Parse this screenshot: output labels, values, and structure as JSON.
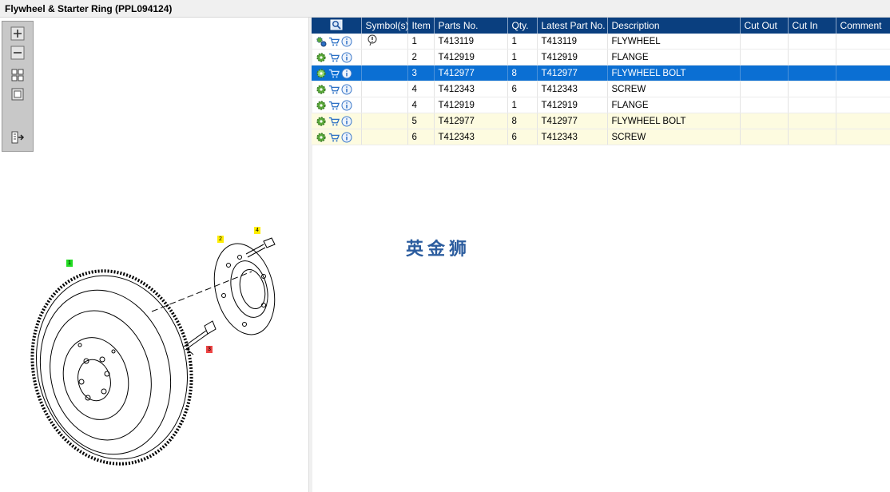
{
  "window": {
    "title": "Flywheel & Starter Ring (PPL094124)"
  },
  "toolbox": {
    "buttons": [
      {
        "name": "zoom-in",
        "icon": "plus-icon"
      },
      {
        "name": "zoom-out",
        "icon": "minus-icon"
      },
      {
        "name": "fit-all",
        "icon": "grid-icon"
      },
      {
        "name": "fit-page",
        "icon": "square-icon"
      },
      {
        "name": "export",
        "icon": "export-icon"
      }
    ]
  },
  "drawing": {
    "callouts": [
      {
        "label": "1",
        "color": "#22dd22"
      },
      {
        "label": "2",
        "color": "#ffee00"
      },
      {
        "label": "3",
        "color": "#ee4444"
      },
      {
        "label": "4",
        "color": "#ffee00"
      }
    ]
  },
  "grid": {
    "columns": [
      "",
      "Symbol(s)",
      "Item",
      "Parts No.",
      "Qty.",
      "Latest Part No.",
      "Description",
      "Cut Out",
      "Cut In",
      "Comment"
    ],
    "rows": [
      {
        "item": "1",
        "part": "T413119",
        "qty": "1",
        "latest": "T413119",
        "desc": "FLYWHEEL",
        "cutout": "",
        "cutin": "",
        "comment": "",
        "state": "normal",
        "symbol": true,
        "gears": "double"
      },
      {
        "item": "2",
        "part": "T412919",
        "qty": "1",
        "latest": "T412919",
        "desc": "FLANGE",
        "cutout": "",
        "cutin": "",
        "comment": "",
        "state": "normal",
        "symbol": false,
        "gears": "single"
      },
      {
        "item": "3",
        "part": "T412977",
        "qty": "8",
        "latest": "T412977",
        "desc": "FLYWHEEL BOLT",
        "cutout": "",
        "cutin": "",
        "comment": "",
        "state": "selected",
        "symbol": false,
        "gears": "single"
      },
      {
        "item": "4",
        "part": "T412343",
        "qty": "6",
        "latest": "T412343",
        "desc": "SCREW",
        "cutout": "",
        "cutin": "",
        "comment": "",
        "state": "normal",
        "symbol": false,
        "gears": "single"
      },
      {
        "item": "4",
        "part": "T412919",
        "qty": "1",
        "latest": "T412919",
        "desc": "FLANGE",
        "cutout": "",
        "cutin": "",
        "comment": "",
        "state": "normal",
        "symbol": false,
        "gears": "single"
      },
      {
        "item": "5",
        "part": "T412977",
        "qty": "8",
        "latest": "T412977",
        "desc": "FLYWHEEL BOLT",
        "cutout": "",
        "cutin": "",
        "comment": "",
        "state": "highlight",
        "symbol": false,
        "gears": "single"
      },
      {
        "item": "6",
        "part": "T412343",
        "qty": "6",
        "latest": "T412343",
        "desc": "SCREW",
        "cutout": "",
        "cutin": "",
        "comment": "",
        "state": "highlight",
        "symbol": false,
        "gears": "single"
      }
    ]
  },
  "watermark": {
    "text": "英金狮"
  },
  "colors": {
    "header": "#0a3f7f",
    "selected": "#0b6fd3",
    "highlight": "#fdfbe0",
    "gear": "#5aa83a",
    "cart": "#2a6fc4",
    "info": "#3b78c9"
  }
}
